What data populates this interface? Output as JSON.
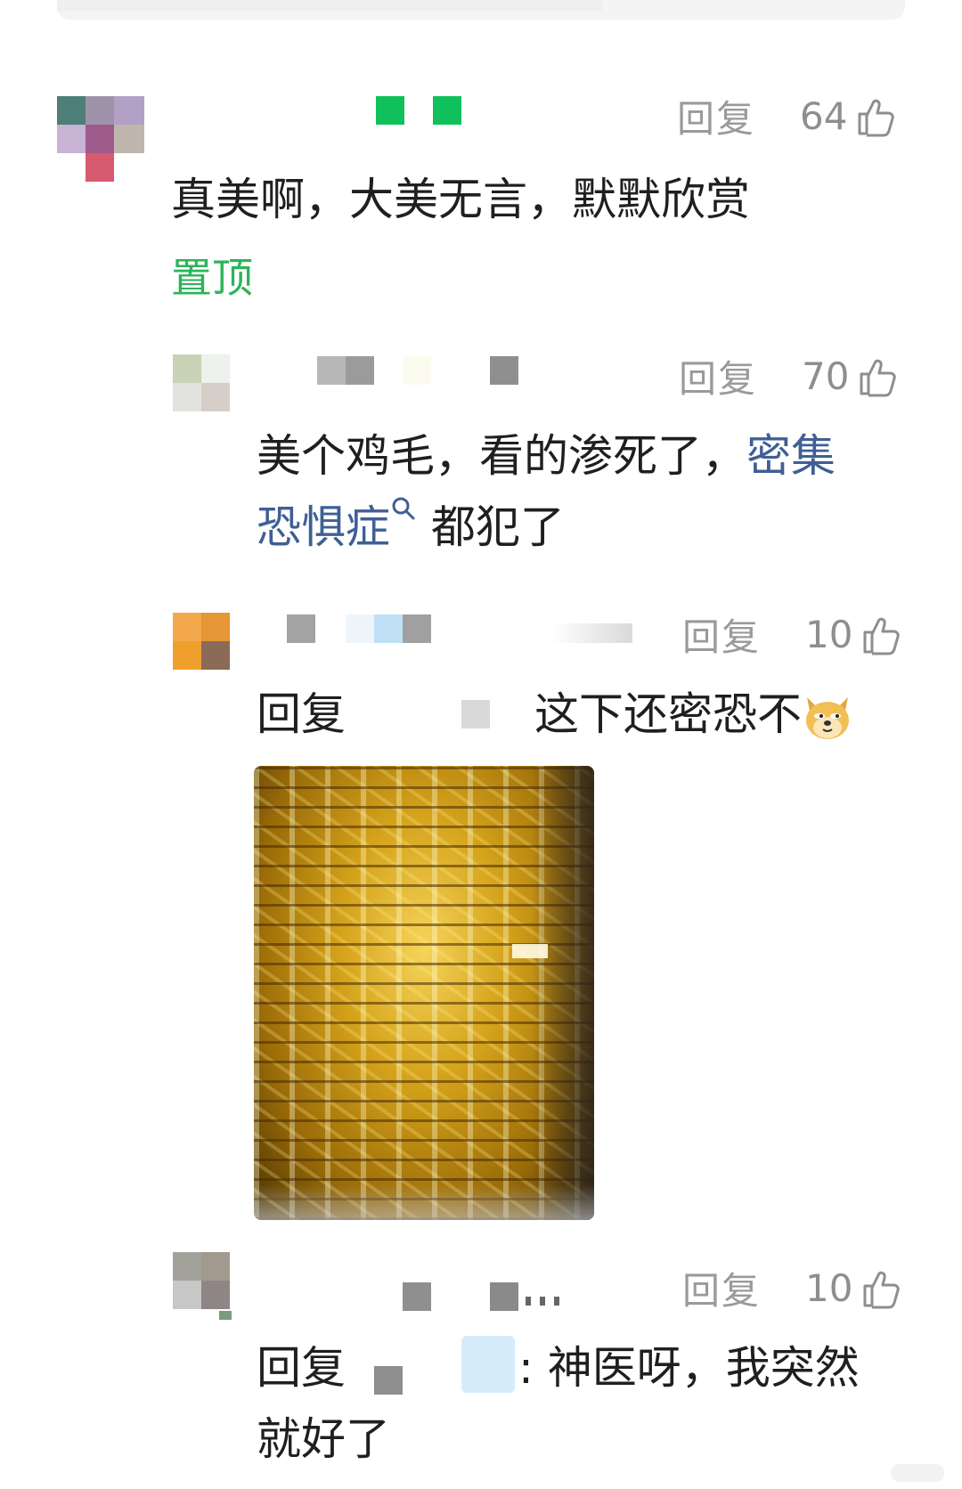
{
  "ui": {
    "colors": {
      "link": "#3f5f95",
      "pinned": "#2eb35a",
      "meta": "#9a9a9a"
    }
  },
  "comments": [
    {
      "reply_label": "回复",
      "likes": "64",
      "text": "真美啊，大美无言，默默欣赏",
      "pinned_label": "置顶"
    },
    {
      "reply_label": "回复",
      "likes": "70",
      "text_part1": "美个鸡毛，看的渗死了，",
      "link_part1": "密集",
      "link_part2": "恐惧症",
      "text_part2": "都犯了"
    },
    {
      "reply_label": "回复",
      "likes": "10",
      "reply_prefix": "回复",
      "text": "这下还密恐不",
      "emoji": "doge-emoji",
      "image_alt": "gold-bars-photo"
    },
    {
      "reply_label": "回复",
      "likes": "10",
      "reply_prefix": "回复",
      "text_part1": ": 神医呀，我突然",
      "text_part2": "就好了"
    }
  ]
}
